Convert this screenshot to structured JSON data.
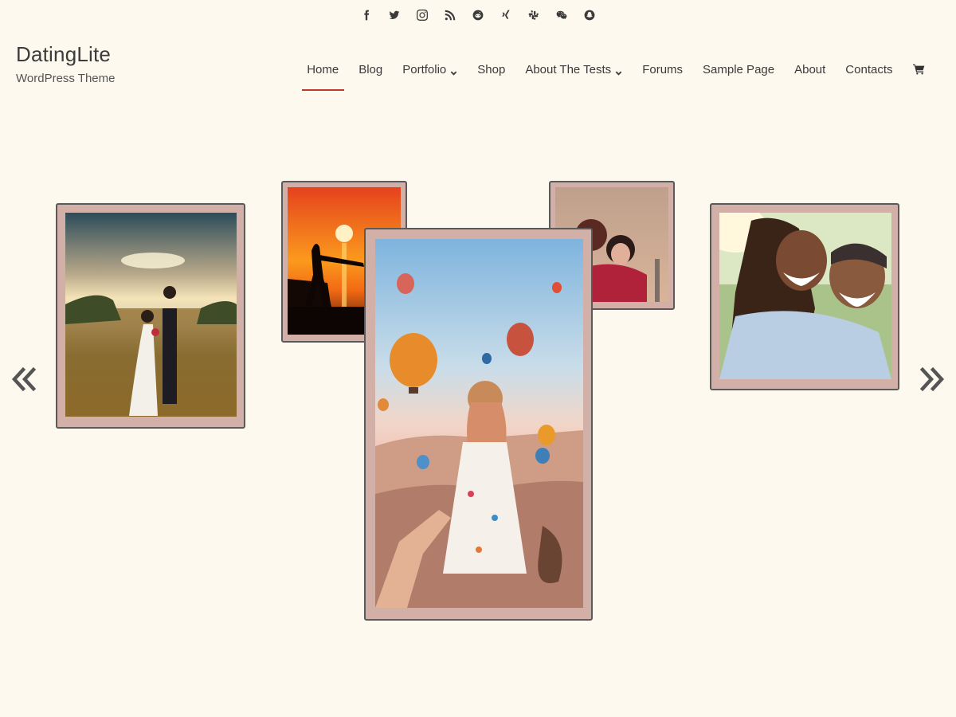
{
  "site": {
    "title": "DatingLite",
    "tagline": "WordPress Theme"
  },
  "social": [
    {
      "name": "facebook-icon"
    },
    {
      "name": "twitter-icon"
    },
    {
      "name": "instagram-icon"
    },
    {
      "name": "rss-icon"
    },
    {
      "name": "reddit-icon"
    },
    {
      "name": "xing-icon"
    },
    {
      "name": "slack-icon"
    },
    {
      "name": "wechat-icon"
    },
    {
      "name": "snapchat-icon"
    }
  ],
  "nav": {
    "items": [
      {
        "label": "Home",
        "active": true,
        "dropdown": false
      },
      {
        "label": "Blog",
        "active": false,
        "dropdown": false
      },
      {
        "label": "Portfolio",
        "active": false,
        "dropdown": true
      },
      {
        "label": "Shop",
        "active": false,
        "dropdown": false
      },
      {
        "label": "About The Tests",
        "active": false,
        "dropdown": true
      },
      {
        "label": "Forums",
        "active": false,
        "dropdown": false
      },
      {
        "label": "Sample Page",
        "active": false,
        "dropdown": false
      },
      {
        "label": "About",
        "active": false,
        "dropdown": false
      },
      {
        "label": "Contacts",
        "active": false,
        "dropdown": false
      }
    ],
    "cart_icon": "shopping-cart-icon",
    "active_underline_color": "#c0392b"
  },
  "gallery": {
    "frame_color": "#d2b0a8",
    "prev_icon": "double-chevron-left-icon",
    "next_icon": "double-chevron-right-icon",
    "photos": [
      {
        "name": "photo-wedding-couple"
      },
      {
        "name": "photo-sunset-silhouette"
      },
      {
        "name": "photo-hot-air-balloons"
      },
      {
        "name": "photo-city-selfie"
      },
      {
        "name": "photo-smiling-couple"
      }
    ]
  }
}
